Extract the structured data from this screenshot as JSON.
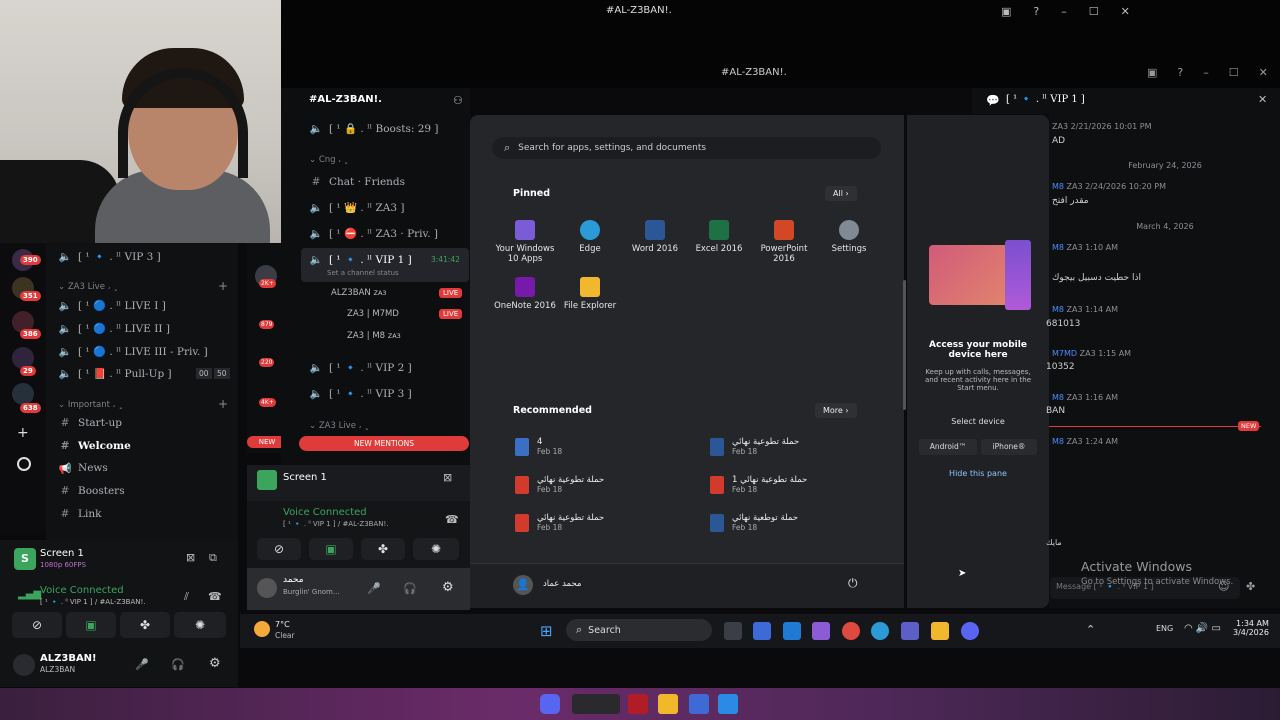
{
  "window_title": "#AL-Z3BAN!.",
  "inner_title": "#AL-Z3BAN!.",
  "server_badges": [
    "390",
    "351",
    "386",
    "29",
    "638"
  ],
  "left_channels": {
    "vip3": "[ ¹ 🔹 . ˡˡ VIP 3 ]",
    "cat_live": "ZA3 Live ، ﮼",
    "live1": "[ ¹ 🔵 . ˡˡ LIVE I ]",
    "live2": "[ ¹ 🔵 . ˡˡ LIVE II ]",
    "live3": "[ ¹ 🔵 . ˡˡ LIVE III - Priv. ]",
    "pullup": "[ ¹ 📕 . ˡˡ Pull-Up ]",
    "pullup_count_a": "00",
    "pullup_count_b": "50",
    "cat_important": "Important ، ﮼",
    "startup": "Start-up",
    "welcome": "Welcome",
    "news": "News",
    "boosters": "Boosters",
    "link": "Link"
  },
  "left_panel": {
    "screen": "Screen 1",
    "screen_sub": "1080p 60FPS",
    "voice": "Voice Connected",
    "voice_sub": "[ ¹ 🔹 . ˡˡ VIP 1 ] / #AL-Z3BAN!.",
    "user": "ALZ3BAN!",
    "user_sub": "ALZ3BAN"
  },
  "mid_server": {
    "name": "#AL-Z3BAN!.",
    "boosts": "[ ¹ 🔒 . ˡˡ Boosts: 29 ]",
    "cat": "Cng ، ﮼",
    "chat": "Chat · Friends",
    "za3": "[ ¹ 👑 . ˡˡ ZA3 ]",
    "za3priv": "[ ¹ ⛔ . ˡˡ ZA3 · Priv. ]",
    "vip1": "[ ¹ 🔹 . ˡˡ VIP 1 ]",
    "vip1_time": "3:41:42",
    "vip1_status": "Set a channel status",
    "member1": "ALZ3BAN",
    "member1_tag": "ZA3",
    "member2": "ZA3 | M7MD",
    "member3": "ZA3 | M8",
    "member3_tag": "ZA3",
    "live_label": "LIVE",
    "vip2": "[ ¹ 🔹 . ˡˡ VIP 2 ]",
    "vip3": "[ ¹ 🔹 . ˡˡ VIP 3 ]",
    "cat_live": "ZA3 Live ، ﮼",
    "new_label": "NEW",
    "new_mentions": "NEW MENTIONS",
    "side_badges": [
      "2K+",
      "879",
      "220",
      "4K+"
    ]
  },
  "mid_panel": {
    "screen": "Screen 1",
    "voice": "Voice Connected",
    "voice_sub": "[ ¹ 🔹 . ˡˡ VIP 1 ] / #AL-Z3BAN!.",
    "user": "محمد",
    "user_sub": "Burglin' Gnom..."
  },
  "start_menu": {
    "search_placeholder": "Search for apps, settings, and documents",
    "pinned_label": "Pinned",
    "all_label": "All",
    "pinned": [
      {
        "name": "Your Windows 10 Apps",
        "color": "#7a5cd6"
      },
      {
        "name": "Edge",
        "color": "#2b9bd8"
      },
      {
        "name": "Word 2016",
        "color": "#2b5797"
      },
      {
        "name": "Excel 2016",
        "color": "#1e7145"
      },
      {
        "name": "PowerPoint 2016",
        "color": "#d24726"
      },
      {
        "name": "Settings",
        "color": "#7f8a96"
      },
      {
        "name": "OneNote 2016",
        "color": "#7719aa"
      },
      {
        "name": "File Explorer",
        "color": "#f1b82d"
      }
    ],
    "recommended_label": "Recommended",
    "more_label": "More",
    "recommended": [
      {
        "name": "4",
        "date": "Feb 18",
        "kind": "doc"
      },
      {
        "name": "حملة تطوعية نهائي",
        "date": "Feb 18",
        "kind": "word"
      },
      {
        "name": "حملة تطوعية نهائي",
        "date": "Feb 18",
        "kind": "pdf"
      },
      {
        "name": "حملة تطوعية نهائي 1",
        "date": "Feb 18",
        "kind": "pdf"
      },
      {
        "name": "حملة تطوعية نهائي",
        "date": "Feb 18",
        "kind": "pdf"
      },
      {
        "name": "حملة توطعية نهائي",
        "date": "Feb 18",
        "kind": "word"
      }
    ],
    "user": "محمد عماد"
  },
  "side_pane": {
    "title": "Access your mobile device here",
    "desc": "Keep up with calls, messages, and recent activity here in the Start menu.",
    "select": "Select device",
    "android": "Android™",
    "iphone": "iPhone®",
    "hide": "Hide this pane"
  },
  "right_chat": {
    "channel": "[ ¹ 🔹 . ˡˡ VIP 1 ]",
    "m1_tag": "ZA3",
    "m1_time": "2/21/2026 10:01 PM",
    "m1_text": "AD",
    "date1": "February 24, 2026",
    "m2_name": "M8",
    "m2_tag": "ZA3",
    "m2_time": "2/24/2026 10:20 PM",
    "m2_text": "مقدر افتح",
    "date2": "March 4, 2026",
    "m3_name": "M8",
    "m3_tag": "ZA3",
    "m3_time": "1:10 AM",
    "m3_text": "اذا حطيت دسبيل بيجوك",
    "m4_name": "M8",
    "m4_tag": "ZA3",
    "m4_time": "1:14 AM",
    "m4_text": "681013",
    "m5_name": "M7MD",
    "m5_tag": "ZA3",
    "m5_time": "1:15 AM",
    "m5_text": "10352",
    "m6_name": "M8",
    "m6_tag": "ZA3",
    "m6_time": "1:16 AM",
    "m6_text": "BAN",
    "m7_name": "M8",
    "m7_tag": "ZA3",
    "m7_time": "1:24 AM",
    "new_label": "NEW",
    "bottom_text": "مايك",
    "input_placeholder": "Message [ ¹ 🔹 . ˡˡ VIP 1 ]",
    "activate": "Activate Windows",
    "activate_sub": "Go to Settings to activate Windows."
  },
  "taskbar": {
    "weather_temp": "7°C",
    "weather_desc": "Clear",
    "search": "Search",
    "lang": "ENG",
    "time": "1:34 AM",
    "date": "3/4/2026"
  }
}
